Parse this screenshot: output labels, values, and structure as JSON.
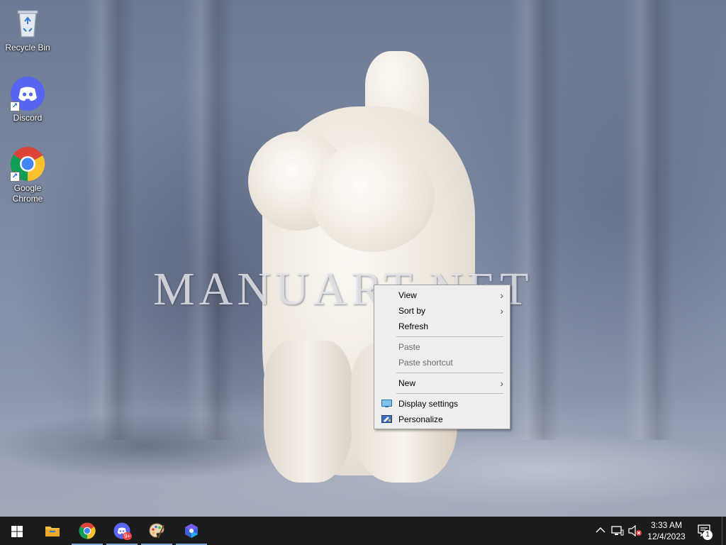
{
  "desktop": {
    "watermark_text": "MANUART.NET",
    "icons": [
      {
        "label": "Recycle Bin"
      },
      {
        "label": "Discord"
      },
      {
        "label": "Google Chrome"
      }
    ]
  },
  "context_menu": {
    "items": [
      {
        "label": "View",
        "submenu": true,
        "enabled": true
      },
      {
        "label": "Sort by",
        "submenu": true,
        "enabled": true
      },
      {
        "label": "Refresh",
        "enabled": true
      },
      {
        "label": "Paste",
        "enabled": false
      },
      {
        "label": "Paste shortcut",
        "enabled": false
      },
      {
        "label": "New",
        "submenu": true,
        "enabled": true
      },
      {
        "label": "Display settings",
        "icon": "display-icon",
        "enabled": true
      },
      {
        "label": "Personalize",
        "icon": "personalize-icon",
        "enabled": true
      }
    ],
    "arrow_glyph": "›"
  },
  "taskbar": {
    "apps": [
      {
        "name": "start",
        "icon": "windows-logo-icon"
      },
      {
        "name": "file-explorer",
        "icon": "folder-icon"
      },
      {
        "name": "google-chrome",
        "icon": "chrome-icon"
      },
      {
        "name": "discord",
        "icon": "discord-icon",
        "badge": "9+"
      },
      {
        "name": "paint",
        "icon": "paint-palette-icon"
      },
      {
        "name": "copilot",
        "icon": "copilot-icon"
      }
    ],
    "tray": {
      "chevron": "^",
      "time": "3:33 AM",
      "date": "12/4/2023",
      "notification_count": "1"
    }
  },
  "colors": {
    "taskbar_bg": "#1b1b1b",
    "menu_bg": "#eeeeee",
    "accent": "#7fa7d6"
  }
}
